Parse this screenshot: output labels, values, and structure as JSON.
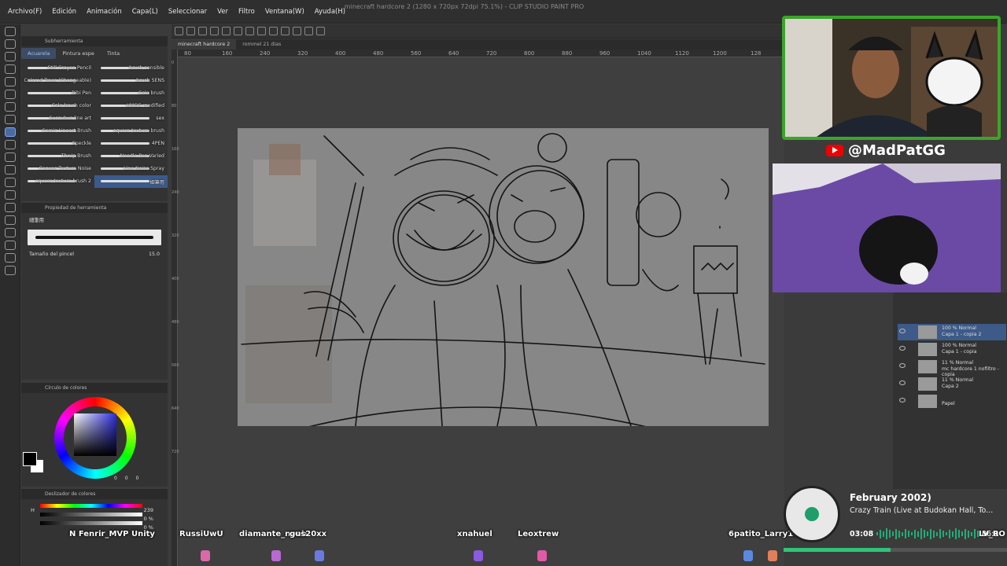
{
  "window_title": "minecraft hardcore 2 (1280 x 720px 72dpi 75.1%) - CLIP STUDIO PAINT PRO",
  "menu": [
    "Archivo(F)",
    "Edición",
    "Animación",
    "Capa(L)",
    "Seleccionar",
    "Ver",
    "Filtro",
    "Ventana(W)",
    "Ayuda(H)"
  ],
  "doc_tabs": [
    "minecraft hardcore 2",
    "rommel 21 dias"
  ],
  "ruler_ticks": [
    "80",
    "160",
    "240",
    "320",
    "400",
    "480",
    "560",
    "640",
    "720",
    "800",
    "880",
    "960",
    "1040",
    "1120",
    "1200",
    "128"
  ],
  "ruler_left_ticks": [
    "0",
    "80",
    "160",
    "240",
    "320",
    "400",
    "480",
    "560",
    "640",
    "720"
  ],
  "subtool": {
    "header": "Subherramienta",
    "tabs": [
      "Acuarela",
      "Pintura espe",
      "Tinta"
    ],
    "brushes": [
      {
        "name": "Still Crayon Pencil",
        "selected": false
      },
      {
        "name": "brush sensible",
        "selected": false
      },
      {
        "name": "Colored Trees (Changeable)",
        "selected": false
      },
      {
        "name": "brush SENS",
        "selected": false
      },
      {
        "name": "Bibi Pen",
        "selected": false
      },
      {
        "name": "Colo brush",
        "selected": false
      },
      {
        "name": "Colo brush color",
        "selected": false
      },
      {
        "name": "HMGG modified",
        "selected": false
      },
      {
        "name": "Succubus line art",
        "selected": false
      },
      {
        "name": "sex",
        "selected": false
      },
      {
        "name": "Comic Lineart Brush",
        "selected": false
      },
      {
        "name": "square texture brush",
        "selected": false
      },
      {
        "name": "Speckle",
        "selected": false
      },
      {
        "name": "4PEN",
        "selected": false
      },
      {
        "name": "Thwip Brush",
        "selected": false
      },
      {
        "name": "Needle Pen Varied",
        "selected": false
      },
      {
        "name": "Canvas Texture Noise",
        "selected": false
      },
      {
        "name": "Line Noise Spray",
        "selected": false
      },
      {
        "name": "square texture brush 2",
        "selected": false
      },
      {
        "name": "細筆用",
        "selected": true
      }
    ]
  },
  "brush_prop": {
    "header": "Propiedad de herramienta",
    "brush_name": "細筆用",
    "size_label": "Tamaño del pincel",
    "size_value": "15.0"
  },
  "color_panel": {
    "header": "Círculo de colores",
    "values": [
      "0",
      "0",
      "0"
    ]
  },
  "slider_panel": {
    "header": "Deslizador de colores",
    "h_label": "H",
    "h_value": "239",
    "s_value": "0 %",
    "v_value": "0 %"
  },
  "webcam_handle": "@MadPatGG",
  "layers": [
    {
      "mode": "100 % Normal",
      "name": "Capa 1 - copia 2",
      "selected": true
    },
    {
      "mode": "100 % Normal",
      "name": "Capa 1 - copia",
      "selected": false
    },
    {
      "mode": "11 % Normal",
      "name": "mc hardcore 1 nofiltro - copia",
      "selected": false
    },
    {
      "mode": "11 % Normal",
      "name": "Capa 2",
      "selected": false
    },
    {
      "mode": "",
      "name": "Papel",
      "selected": false
    }
  ],
  "chat_names": [
    "N Fenrir_MVP Unity",
    "RussiUwU",
    "diamante_noob",
    "gus20xx",
    "xnahuel",
    "Leoxtrew",
    "6patito_Larry12",
    "LV_RO"
  ],
  "music": {
    "title": "February 2002)",
    "subtitle": "Crazy Train (Live at Budokan Hall, To...",
    "time_current": "03:08",
    "time_total": "06:0",
    "progress": 0.48
  },
  "colors": {
    "accent": "#4a78c8",
    "webcam_border": "#3ba52a",
    "progress": "#2ec47a"
  }
}
